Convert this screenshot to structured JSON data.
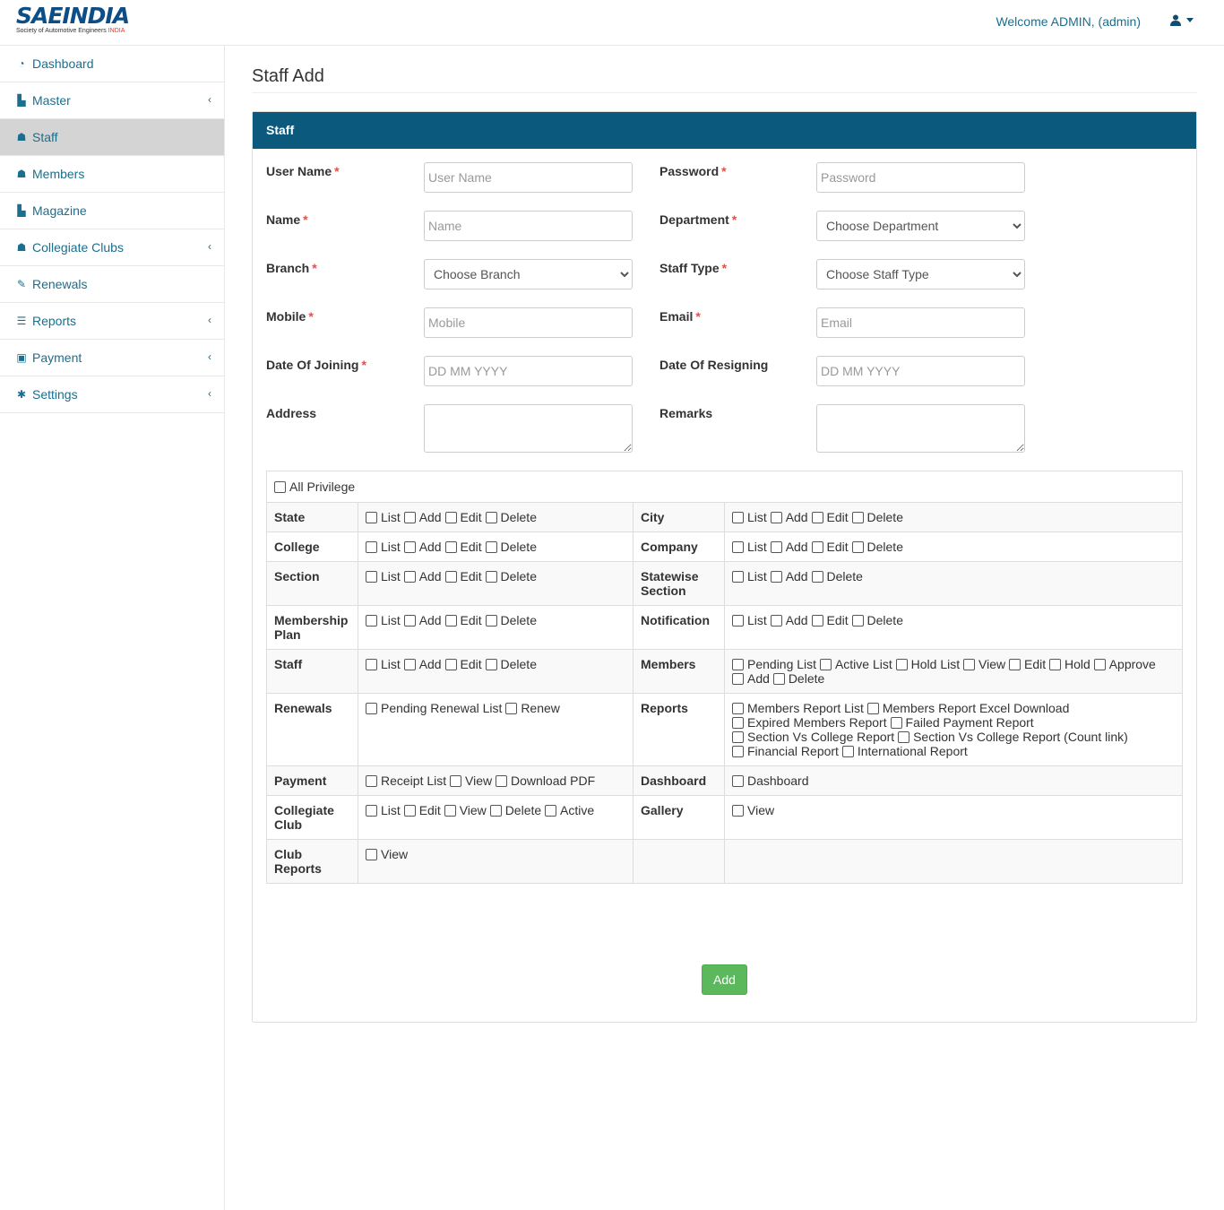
{
  "header": {
    "logo_text": "SAEINDIA",
    "logo_subtitle": "Society of Automotive Engineers",
    "logo_subtitle_accent": "INDIA",
    "welcome": "Welcome ADMIN, (admin)",
    "user_icon": "user-icon",
    "caret_icon": "caret-down-icon"
  },
  "sidebar": {
    "items": [
      {
        "label": "Dashboard",
        "icon": "dashboard-icon",
        "glyph": "◔",
        "chevron": false,
        "active": false
      },
      {
        "label": "Master",
        "icon": "file-icon",
        "glyph": "▙",
        "chevron": true,
        "active": false
      },
      {
        "label": "Staff",
        "icon": "user-icon",
        "glyph": "☗",
        "chevron": false,
        "active": true
      },
      {
        "label": "Members",
        "icon": "users-icon",
        "glyph": "☗",
        "chevron": false,
        "active": false
      },
      {
        "label": "Magazine",
        "icon": "file-icon",
        "glyph": "▙",
        "chevron": false,
        "active": false
      },
      {
        "label": "Collegiate Clubs",
        "icon": "user-icon",
        "glyph": "☗",
        "chevron": true,
        "active": false
      },
      {
        "label": "Renewals",
        "icon": "edit-icon",
        "glyph": "✎",
        "chevron": false,
        "active": false
      },
      {
        "label": "Reports",
        "icon": "list-icon",
        "glyph": "☰",
        "chevron": true,
        "active": false
      },
      {
        "label": "Payment",
        "icon": "money-icon",
        "glyph": "▣",
        "chevron": true,
        "active": false
      },
      {
        "label": "Settings",
        "icon": "gear-icon",
        "glyph": "✱",
        "chevron": true,
        "active": false
      }
    ],
    "chevron_glyph": "‹"
  },
  "page": {
    "title": "Staff Add",
    "panel_title": "Staff"
  },
  "form": {
    "username_label": "User Name",
    "username_placeholder": "User Name",
    "password_label": "Password",
    "password_placeholder": "Password",
    "name_label": "Name",
    "name_placeholder": "Name",
    "department_label": "Department",
    "department_value": "Choose Department",
    "branch_label": "Branch",
    "branch_value": "Choose Branch",
    "stafftype_label": "Staff Type",
    "stafftype_value": "Choose Staff Type",
    "mobile_label": "Mobile",
    "mobile_placeholder": "Mobile",
    "email_label": "Email",
    "email_placeholder": "Email",
    "doj_label": "Date Of Joining",
    "doj_placeholder": "DD MM YYYY",
    "dor_label": "Date Of Resigning",
    "dor_placeholder": "DD MM YYYY",
    "address_label": "Address",
    "remarks_label": "Remarks",
    "required_mark": "*"
  },
  "privileges": {
    "all_label": "All Privilege",
    "rows": [
      {
        "left": {
          "label": "State",
          "opts": [
            "List",
            "Add",
            "Edit",
            "Delete"
          ]
        },
        "right": {
          "label": "City",
          "opts": [
            "List",
            "Add",
            "Edit",
            "Delete"
          ]
        }
      },
      {
        "left": {
          "label": "College",
          "opts": [
            "List",
            "Add",
            "Edit",
            "Delete"
          ]
        },
        "right": {
          "label": "Company",
          "opts": [
            "List",
            "Add",
            "Edit",
            "Delete"
          ]
        }
      },
      {
        "left": {
          "label": "Section",
          "opts": [
            "List",
            "Add",
            "Edit",
            "Delete"
          ]
        },
        "right": {
          "label": "Statewise Section",
          "opts": [
            "List",
            "Add",
            "Delete"
          ]
        }
      },
      {
        "left": {
          "label": "Membership Plan",
          "opts": [
            "List",
            "Add",
            "Edit",
            "Delete"
          ]
        },
        "right": {
          "label": "Notification",
          "opts": [
            "List",
            "Add",
            "Edit",
            "Delete"
          ]
        }
      },
      {
        "left": {
          "label": "Staff",
          "opts": [
            "List",
            "Add",
            "Edit",
            "Delete"
          ]
        },
        "right": {
          "label": "Members",
          "opts": [
            "Pending List",
            "Active List",
            "Hold List",
            "View",
            "Edit",
            "Hold",
            "Approve",
            "Add",
            "Delete"
          ]
        }
      },
      {
        "left": {
          "label": "Renewals",
          "opts": [
            "Pending Renewal List",
            "Renew"
          ]
        },
        "right": {
          "label": "Reports",
          "opts": [
            "Members Report List",
            "Members Report Excel Download",
            "Expired Members Report",
            "Failed Payment Report",
            "Section Vs College Report",
            "Section Vs College Report (Count link)",
            "Financial Report",
            "International Report"
          ]
        }
      },
      {
        "left": {
          "label": "Payment",
          "opts": [
            "Receipt List",
            "View",
            "Download PDF"
          ]
        },
        "right": {
          "label": "Dashboard",
          "opts": [
            "Dashboard"
          ]
        }
      },
      {
        "left": {
          "label": "Collegiate Club",
          "opts": [
            "List",
            "Edit",
            "View",
            "Delete",
            "Active"
          ]
        },
        "right": {
          "label": "Gallery",
          "opts": [
            "View"
          ]
        }
      },
      {
        "left": {
          "label": "Club Reports",
          "opts": [
            "View"
          ]
        },
        "right": {
          "label": "",
          "opts": []
        }
      }
    ]
  },
  "buttons": {
    "add": "Add"
  }
}
